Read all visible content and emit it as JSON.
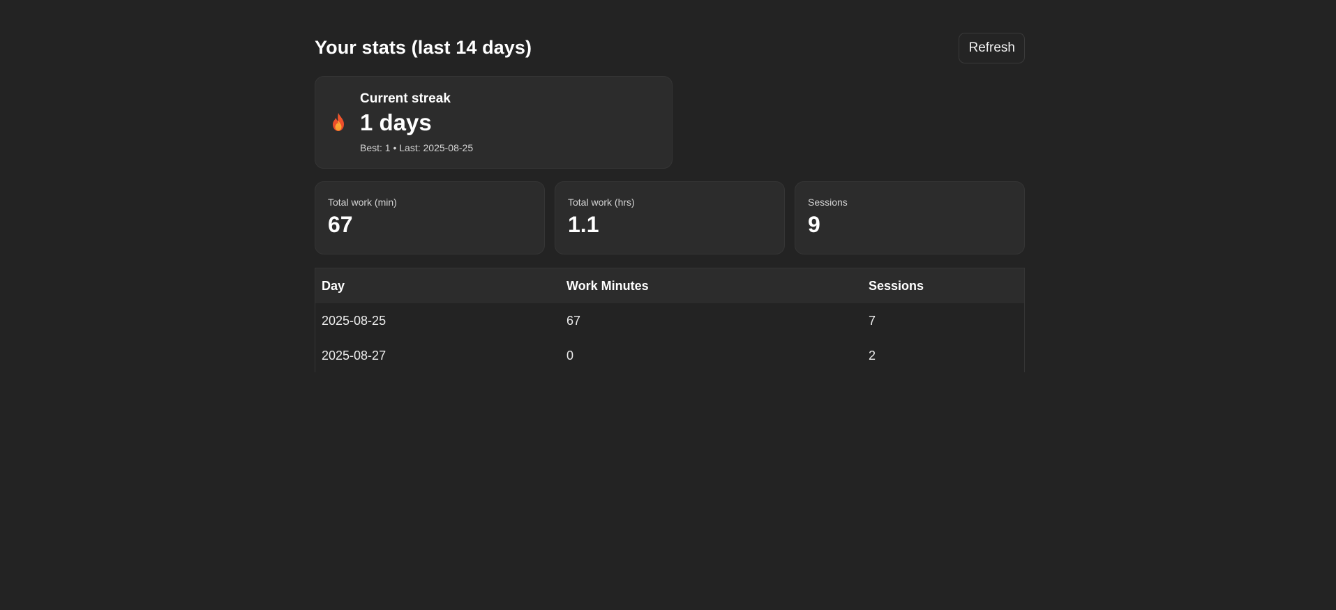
{
  "header": {
    "title": "Your stats (last 14 days)",
    "refresh_label": "Refresh"
  },
  "streak": {
    "title": "Current streak",
    "value": "1 days",
    "meta": "Best: 1 • Last: 2025-08-25",
    "icon": "flame-icon"
  },
  "stats": [
    {
      "label": "Total work (min)",
      "value": "67"
    },
    {
      "label": "Total work (hrs)",
      "value": "1.1"
    },
    {
      "label": "Sessions",
      "value": "9"
    }
  ],
  "table": {
    "headers": [
      "Day",
      "Work Minutes",
      "Sessions"
    ],
    "rows": [
      [
        "2025-08-25",
        "67",
        "7"
      ],
      [
        "2025-08-27",
        "0",
        "2"
      ]
    ]
  },
  "colors": {
    "background": "#232323",
    "card": "#2c2c2c",
    "text": "#ffffff"
  }
}
